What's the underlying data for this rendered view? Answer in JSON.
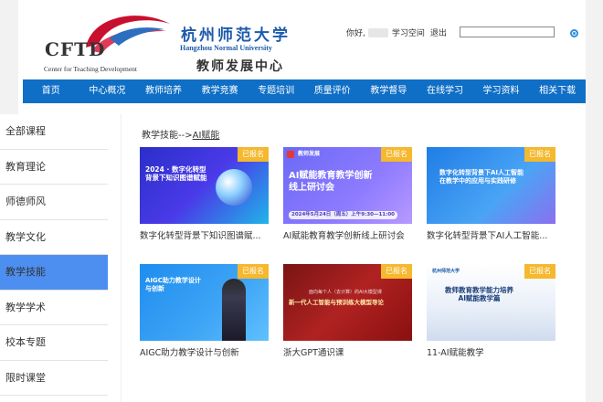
{
  "header": {
    "logo_text": "CFTD",
    "logo_subtitle": "Center for Teaching Development",
    "university_cn": "杭州师范大学",
    "university_en": "Hangzhou Normal University",
    "center_cn": "教师发展中心",
    "greeting": "你好,",
    "study_space": "学习空间",
    "logout": "退出",
    "search_placeholder": ""
  },
  "nav": [
    "首页",
    "中心概况",
    "教师培养",
    "教学竞赛",
    "专题培训",
    "质量评价",
    "教学督导",
    "在线学习",
    "学习资料",
    "相关下载"
  ],
  "sidebar": [
    "全部课程",
    "教育理论",
    "师德师风",
    "教学文化",
    "教学技能",
    "教学学术",
    "校本专题",
    "限时课堂"
  ],
  "sidebar_active": "教学技能",
  "breadcrumb": {
    "parent": "教学技能-->",
    "current": "AI赋能"
  },
  "courses": [
    {
      "title": "数字化转型背景下知识图谱赋...",
      "badge": "已报名",
      "thumb_text": "2024 · 数字化转型\n背景下知识图谱赋能"
    },
    {
      "title": "AI赋能教育教学创新线上研讨会",
      "badge": "已报名",
      "thumb_text": "AI赋能教育教学创新\n线上研讨会",
      "thumb_sub": "2024年5月24日（周五）上午9:30—11:00",
      "thumb_brand": "教师发展"
    },
    {
      "title": "数字化转型背景下AI人工智能...",
      "badge": "已报名",
      "thumb_text": "数字化转型背景下AI人工智能\n在教学中的应用与实践研修"
    },
    {
      "title": "AIGC助力教学设计与创新",
      "badge": "已报名",
      "thumb_text": "AIGC助力教学设计\n与创新"
    },
    {
      "title": "浙大GPT通识课",
      "badge": "已报名",
      "thumb_text": "新一代人工智能与预训练大模型导论",
      "thumb_sub": "面向每个人（去计算）的AI大模型课"
    },
    {
      "title": "11-AI赋能教学",
      "badge": "已报名",
      "thumb_text": "教师教育教学能力培养\nAI赋能教学篇",
      "thumb_brand": "杭州师范大学"
    }
  ],
  "colors": {
    "nav_bg": "#0f6fc6",
    "active_side": "#4d8ff0",
    "badge": "#f5b82e",
    "brand_blue": "#1c5bab"
  }
}
